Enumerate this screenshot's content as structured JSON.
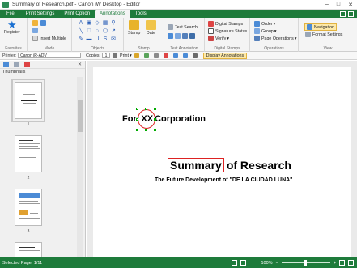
{
  "window": {
    "title": "Summary of Research.pdf - Canon iW Desktop - Editor",
    "buttons": {
      "minimize": "–",
      "maximize": "□",
      "close": "✕"
    }
  },
  "menu": {
    "file": "File",
    "tabs": [
      "Print Settings",
      "Print Option",
      "Annotations",
      "Tools"
    ],
    "active_tab": "Annotations"
  },
  "ribbon": {
    "favorites": {
      "register": "Register",
      "label": "Favorites"
    },
    "mode": {
      "insert_multiple": "Insert Multiple",
      "label": "Mode"
    },
    "objects": {
      "label": "Objects"
    },
    "stamp": {
      "stamp": "Stamp",
      "date": "Date",
      "label": "Stamp"
    },
    "text_annotation": {
      "text_search": "Text Search",
      "label": "Text Annotation"
    },
    "digital_stamps": {
      "digital_stamps": "Digital Stamps",
      "signature_status": "Signature Status",
      "verify": "Verify",
      "label": "Digital Stamps"
    },
    "operations": {
      "order": "Order",
      "group": "Group",
      "page_operations": "Page Operations",
      "label": "Operations"
    },
    "view": {
      "navigation": "Navigation",
      "format_settings": "Format Settings",
      "label": "View"
    }
  },
  "toolbar": {
    "printer_label": "Printer:",
    "printer_value": "Canon iR-ADV",
    "copies_label": "Copies:",
    "copies_value": "1",
    "print": "Print",
    "display_annotations": "Display Annotations"
  },
  "sidebar": {
    "title": "Thumbnails",
    "close": "✕",
    "pages": [
      "1",
      "2",
      "3"
    ]
  },
  "document": {
    "for_prefix": "For:",
    "for_highlight": "XX",
    "for_suffix": "Corporation",
    "summary_highlight": "Summary",
    "summary_rest": "of Research",
    "subtitle": "The Future Development of \"DE LA CIUDAD LUNA\""
  },
  "status": {
    "selected_page": "Selected Page: 1/11",
    "zoom": "100%"
  },
  "colors": {
    "brand_green": "#1e7b3b",
    "annotation_red": "#d22222",
    "highlight": "#fde9a8"
  }
}
